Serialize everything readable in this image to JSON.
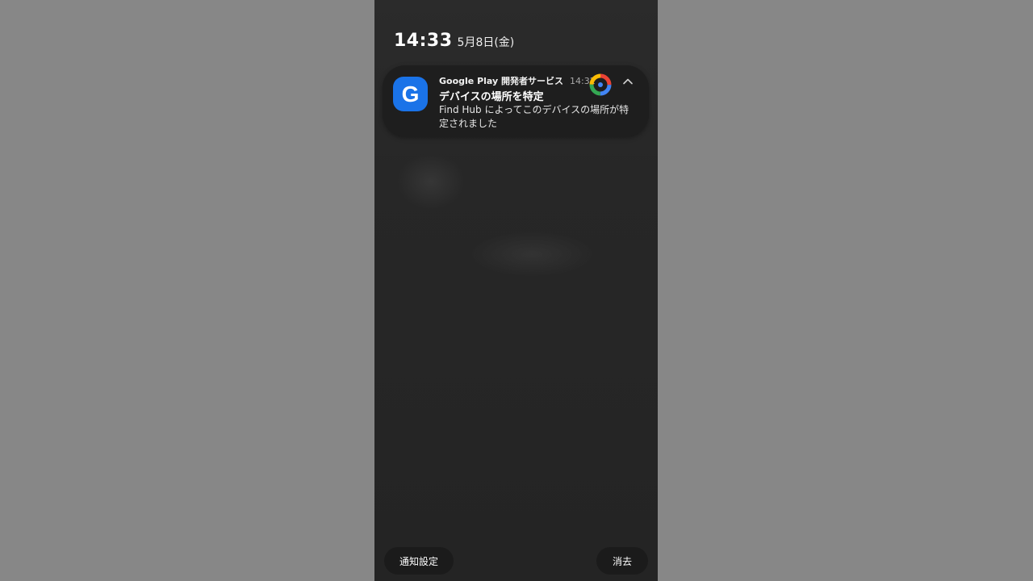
{
  "status_bar": {
    "time": "14:33",
    "date": "5月8日(金)"
  },
  "notification": {
    "app_icon": "google-g-icon",
    "app_icon_letter": "G",
    "app_name": "Google Play 開発者サービス",
    "time": "14:32",
    "title": "デバイスの場所を特定",
    "body": "Find Hub によってこのデバイスの場所が特定されました",
    "large_icon": "find-hub-icon",
    "collapse_icon": "chevron-up-icon"
  },
  "actions": {
    "notification_settings": "通知設定",
    "clear_all": "消去"
  },
  "colors": {
    "app_icon_bg": "#1a73e8",
    "card_bg": "#1e1e1e",
    "screen_bg": "#262626",
    "outer_bg": "#878787"
  }
}
